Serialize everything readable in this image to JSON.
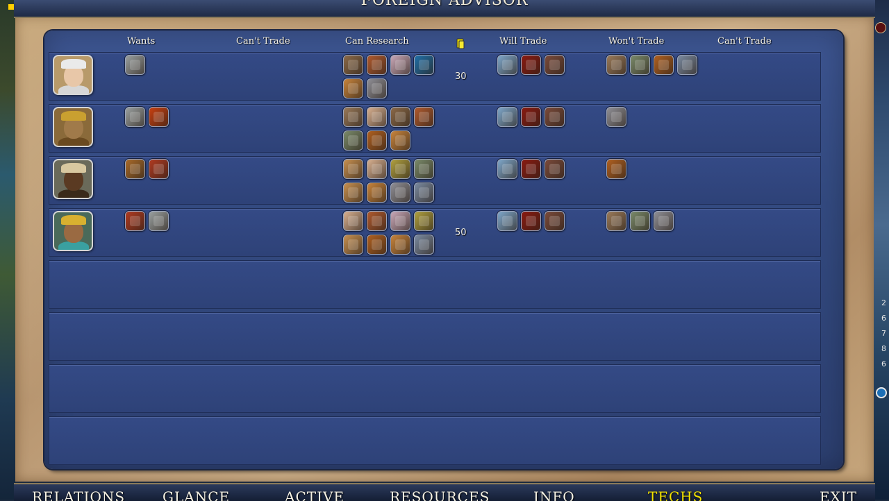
{
  "window": {
    "title": "FOREIGN ADVISOR"
  },
  "columns": {
    "wants": "Wants",
    "cant_trade_1": "Can't Trade",
    "can_research": "Can Research",
    "gold_icon": "gold-icon",
    "will_trade": "Will Trade",
    "wont_trade": "Won't Trade",
    "cant_trade_2": "Can't Trade"
  },
  "leaders": [
    {
      "portrait": "leader-portrait-1",
      "skin": "#e8c7a8",
      "hat": "#eaeaea",
      "garment": "#d7d7d7",
      "bg": "#b89a6a",
      "wants": [
        "#9aa0a0"
      ],
      "can_research": [
        "#8c6a48",
        "#b05a2e",
        "#c9a8b8",
        "#1f6fa8",
        "#c8843c",
        "#8f8f96"
      ],
      "gold": "30",
      "will_trade": [
        "#7ea6c9",
        "#8a1a10",
        "#7a4a3a"
      ],
      "wont_trade": [
        "#9a7a5a",
        "#7a8a6a",
        "#b06020",
        "#7a8aa0"
      ]
    },
    {
      "portrait": "leader-portrait-2",
      "skin": "#a07a4a",
      "hat": "#c9a030",
      "garment": "#6a4a20",
      "bg": "#8a6a3a",
      "wants": [
        "#9aa0a0",
        "#c84010"
      ],
      "can_research": [
        "#9a7a5a",
        "#d8b090",
        "#8c6a48",
        "#b05a2e",
        "#7a8a6a",
        "#b06020",
        "#c8843c"
      ],
      "gold": "",
      "will_trade": [
        "#7ea6c9",
        "#8a1a10",
        "#7a4a3a"
      ],
      "wont_trade": [
        "#8f8f96"
      ]
    },
    {
      "portrait": "leader-portrait-3",
      "skin": "#5a3a22",
      "hat": "#d8c8a0",
      "garment": "#3a2a1a",
      "bg": "#6a6a5a",
      "wants": [
        "#a86a2a",
        "#b03a20"
      ],
      "can_research": [
        "#c89050",
        "#d8b090",
        "#b0a040",
        "#7a8a6a",
        "#c89050",
        "#c8843c",
        "#8f8f96",
        "#7a8aa0"
      ],
      "gold": "",
      "will_trade": [
        "#7ea6c9",
        "#8a1a10",
        "#7a4a3a"
      ],
      "wont_trade": [
        "#b06020"
      ]
    },
    {
      "portrait": "leader-portrait-4",
      "skin": "#9a6a42",
      "hat": "#d8b030",
      "garment": "#3aa0a0",
      "bg": "#4a6a5a",
      "wants": [
        "#b03a20",
        "#9aa0a0"
      ],
      "can_research": [
        "#d8b090",
        "#b05a2e",
        "#c9a8b8",
        "#b0a040",
        "#c89050",
        "#b06020",
        "#c8843c",
        "#7a8aa0"
      ],
      "gold": "50",
      "will_trade": [
        "#7ea6c9",
        "#8a1a10",
        "#7a4a3a"
      ],
      "wont_trade": [
        "#9a7a5a",
        "#7a8a6a",
        "#8f8f96"
      ]
    }
  ],
  "side_numbers": [
    "2",
    "6",
    "7",
    "8",
    "6"
  ],
  "nav": [
    {
      "label": "RELATIONS",
      "active": false
    },
    {
      "label": "GLANCE",
      "active": false
    },
    {
      "label": "ACTIVE",
      "active": false
    },
    {
      "label": "RESOURCES",
      "active": false
    },
    {
      "label": "INFO",
      "active": false
    },
    {
      "label": "TECHS",
      "active": true
    },
    {
      "label": "EXIT",
      "active": false
    }
  ]
}
